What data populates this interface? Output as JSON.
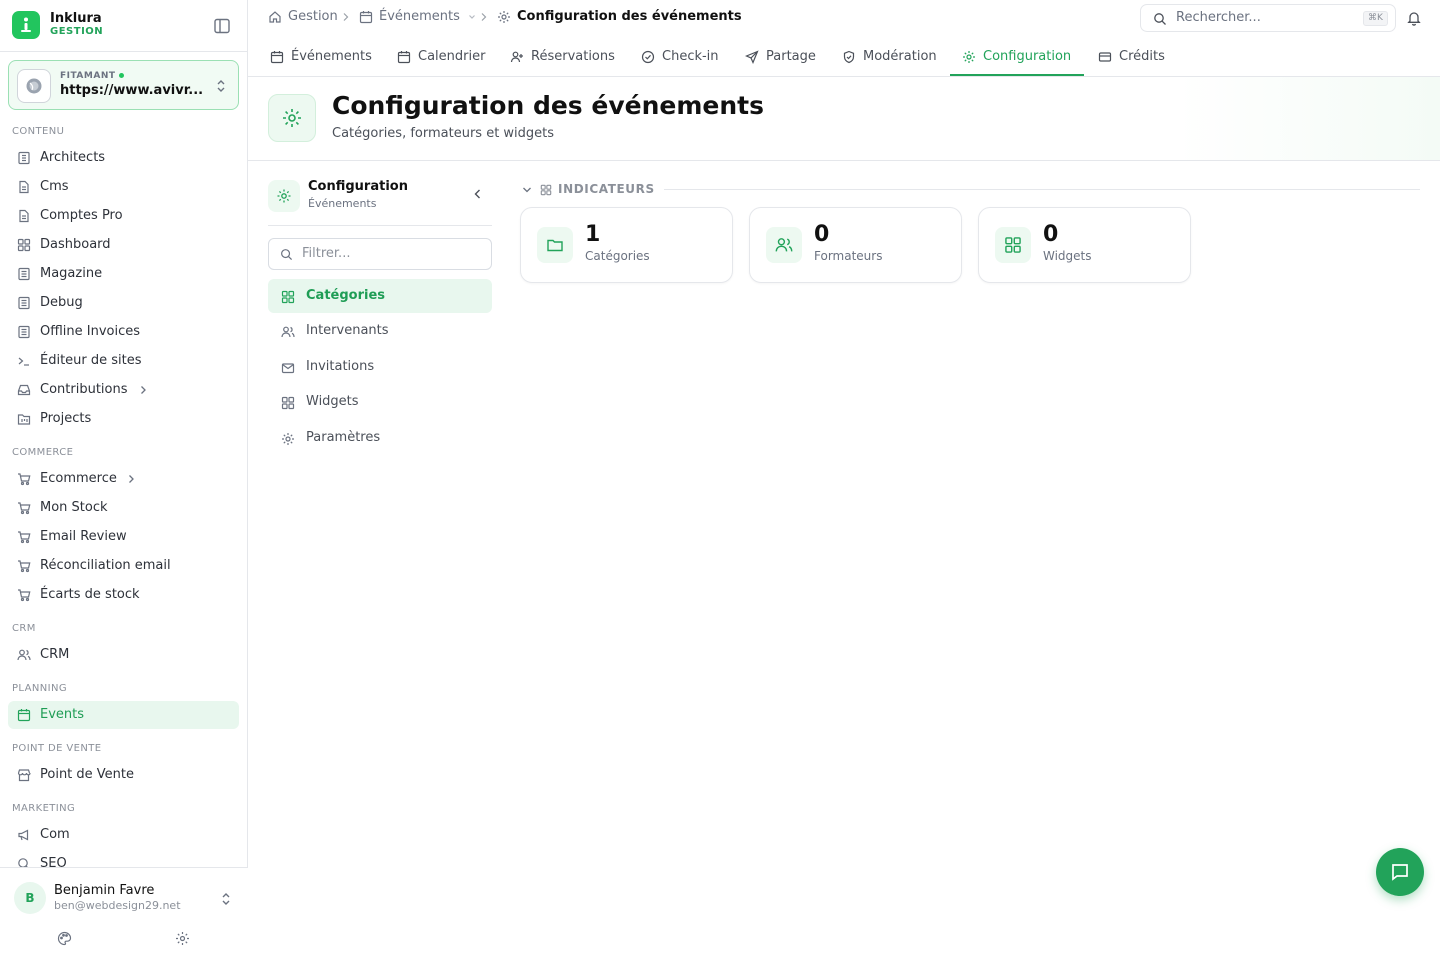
{
  "brand": {
    "name": "Inklura",
    "subtitle": "GESTION"
  },
  "site": {
    "label": "FITAMANT",
    "url": "https://www.avivr..."
  },
  "sidebar": {
    "sections": {
      "contenu": "CONTENU",
      "commerce": "COMMERCE",
      "crm": "CRM",
      "planning": "PLANNING",
      "pdv": "POINT DE VENTE",
      "marketing": "MARKETING"
    },
    "items": {
      "architects": "Architects",
      "cms": "Cms",
      "comptes_pro": "Comptes Pro",
      "dashboard": "Dashboard",
      "magazine": "Magazine",
      "debug": "Debug",
      "offline_invoices": "Offline Invoices",
      "editeur": "Éditeur de sites",
      "contributions": "Contributions",
      "projects": "Projects",
      "ecommerce": "Ecommerce",
      "mon_stock": "Mon Stock",
      "email_review": "Email Review",
      "reconciliation": "Réconciliation email",
      "ecarts": "Écarts de stock",
      "crm": "CRM",
      "events": "Events",
      "pdv": "Point de Vente",
      "com": "Com",
      "seo": "SEO"
    }
  },
  "user": {
    "initial": "B",
    "name": "Benjamin Favre",
    "email": "ben@webdesign29.net"
  },
  "breadcrumb": {
    "root": "Gestion",
    "section": "Événements",
    "current": "Configuration des événements"
  },
  "search": {
    "placeholder": "Rechercher...",
    "shortcut": "⌘K"
  },
  "tabs": {
    "evenements": "Événements",
    "calendrier": "Calendrier",
    "reservations": "Réservations",
    "checkin": "Check-in",
    "partage": "Partage",
    "moderation": "Modération",
    "configuration": "Configuration",
    "credits": "Crédits"
  },
  "page": {
    "title": "Configuration des événements",
    "subtitle": "Catégories, formateurs et widgets"
  },
  "config_panel": {
    "title": "Configuration",
    "subtitle": "Événements",
    "filter_placeholder": "Filtrer...",
    "items": {
      "categories": "Catégories",
      "intervenants": "Intervenants",
      "invitations": "Invitations",
      "widgets": "Widgets",
      "parametres": "Paramètres"
    }
  },
  "indicators": {
    "label": "INDICATEURS",
    "cards": {
      "categories": {
        "value": "1",
        "label": "Catégories"
      },
      "formateurs": {
        "value": "0",
        "label": "Formateurs"
      },
      "widgets": {
        "value": "0",
        "label": "Widgets"
      }
    }
  },
  "colors": {
    "accent": "#22a35a",
    "accent_bg": "#e8f7ee",
    "border": "#e5e7eb"
  }
}
